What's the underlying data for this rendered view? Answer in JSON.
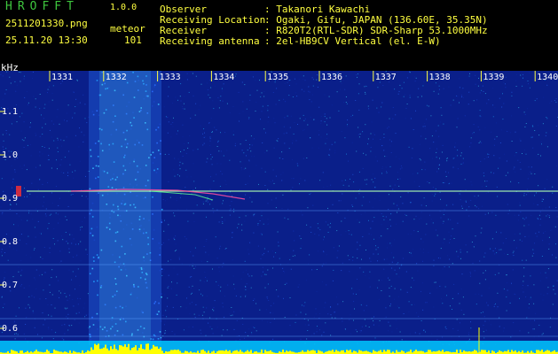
{
  "header": {
    "app_name": "HROFFT",
    "version": "1.0.0",
    "filename": "2511201330.png",
    "datetime": "25.11.20 13:30",
    "mode_label": "meteor",
    "count": "101",
    "info": [
      {
        "label": "Observer",
        "value": ": Takanori Kawachi"
      },
      {
        "label": "Receiving Location",
        "value": ": Ogaki, Gifu, JAPAN (136.60E, 35.35N)"
      },
      {
        "label": "Receiver",
        "value": ": R820T2(RTL-SDR) SDR-Sharp 53.1000MHz"
      },
      {
        "label": "Receiving antenna",
        "value": ": 2el-HB9CV Vertical (el. E-W)"
      }
    ]
  },
  "spectrogram": {
    "freq_unit": "kHz",
    "time_ticks": [
      "1331",
      "1332",
      "1333",
      "1334",
      "1335",
      "1336",
      "1337",
      "1338",
      "1339",
      "1340"
    ],
    "freq_ticks": [
      "1.1",
      "1.0",
      "0.9",
      "0.8",
      "0.7",
      "0.6"
    ],
    "colors": {
      "background": "#0a1f8a",
      "carrier": "#b0ffb0",
      "axis_text": "#ffffff",
      "tick_mark": "#ffff40",
      "level_bar": "#ffff00",
      "floor_band": "#00c8ff"
    }
  }
}
